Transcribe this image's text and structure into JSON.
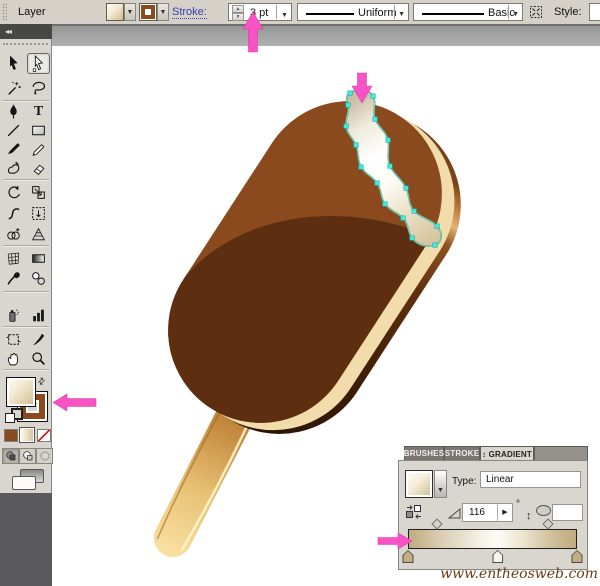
{
  "toolbar": {
    "layer_label": "Layer",
    "stroke_label": "Stroke:",
    "stroke_value": "3 pt",
    "width_profile_value": "Uniform",
    "brush_definition_value": "Basic",
    "style_label": "Style:",
    "fill_swatch": "cream linear gradient",
    "stroke_swatch_color": "#8a4a1e"
  },
  "tools_panel": {
    "collapse_glyph": "◂◂",
    "selected_tool": "direct-selection-tool",
    "tools": [
      "selection-tool",
      "direct-selection-tool",
      "magic-wand-tool",
      "lasso-tool",
      "pen-tool",
      "type-tool",
      "line-segment-tool",
      "rectangle-tool",
      "paintbrush-tool",
      "pencil-tool",
      "blob-brush-tool",
      "eraser-tool",
      "rotate-tool",
      "scale-tool",
      "width-tool",
      "free-transform-tool",
      "shape-builder-tool",
      "perspective-grid-tool",
      "mesh-tool",
      "gradient-tool",
      "eyedropper-tool",
      "blend-tool",
      "symbol-sprayer-tool",
      "column-graph-tool",
      "artboard-tool",
      "slice-tool",
      "hand-tool",
      "zoom-tool"
    ],
    "fill_proxy": "cream linear gradient",
    "stroke_proxy_color": "#8a4a1e",
    "active_paint_mode": "gradient"
  },
  "canvas": {
    "artwork": "chocolate ice cream bar on a wooden stick with a vanilla bite revealed at the top right edge",
    "selection": "vanilla bite path selected with cyan anchor points"
  },
  "gradient_panel": {
    "tabs": [
      {
        "label": "BRUSHES"
      },
      {
        "label": "STROKE"
      },
      {
        "label": "↕ GRADIENT"
      }
    ],
    "type_label": "Type:",
    "type_value": "Linear",
    "angle_value": "116",
    "degree_symbol": "°",
    "stops": [
      {
        "position": "0%",
        "color": "#c4ad80"
      },
      {
        "position": "53%",
        "color": "#f8f6ee"
      },
      {
        "position": "100%",
        "color": "#c4ad80"
      }
    ],
    "midpoints": [
      {
        "position": "17%"
      },
      {
        "position": "83%"
      }
    ]
  },
  "annotations": {
    "arrow_color": "#f852c4",
    "arrows": [
      "points up at stroke weight 3 pt",
      "points down at vanilla bite shape",
      "points left at stroke proxy swatch",
      "points right at gradient slider"
    ]
  },
  "watermark": "www.entheosweb.com",
  "icons": {
    "dropdown-arrow": "▾",
    "spinner-up": "▲",
    "spinner-down": "▼",
    "right-spinner-arrow": "▶",
    "swap-fill-stroke": "⇄",
    "panel-collapse": "◂◂"
  }
}
